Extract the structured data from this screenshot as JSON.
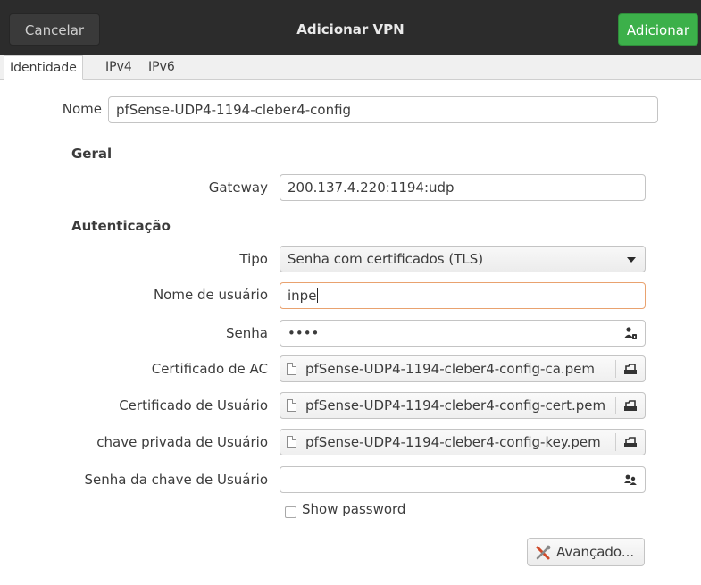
{
  "header": {
    "cancel_label": "Cancelar",
    "title": "Adicionar VPN",
    "add_label": "Adicionar"
  },
  "tabs": [
    {
      "label": "Identidade"
    },
    {
      "label": "IPv4"
    },
    {
      "label": "IPv6"
    }
  ],
  "form": {
    "name_label": "Nome",
    "name_value": "pfSense-UDP4-1194-cleber4-config",
    "general_heading": "Geral",
    "gateway_label": "Gateway",
    "gateway_value": "200.137.4.220:1194:udp",
    "auth_heading": "Autenticação",
    "type_label": "Tipo",
    "type_value": "Senha com certificados (TLS)",
    "username_label": "Nome de usuário",
    "username_value": "inpe",
    "password_label": "Senha",
    "password_value": "••••",
    "ca_cert_label": "Certificado de AC",
    "ca_cert_file": "pfSense-UDP4-1194-cleber4-config-ca.pem",
    "user_cert_label": "Certificado de Usuário",
    "user_cert_file": "pfSense-UDP4-1194-cleber4-config-cert.pem",
    "user_key_label": "chave privada de Usuário",
    "user_key_file": "pfSense-UDP4-1194-cleber4-config-key.pem",
    "key_password_label": "Senha da chave de Usuário",
    "key_password_value": "",
    "show_password_label": "Show password",
    "advanced_label": "Avançado..."
  },
  "colors": {
    "header_bg": "#2c2c2c",
    "add_button": "#3cb04a",
    "focus_border": "#e9a26f"
  },
  "icons": {
    "password_field": "user-password-icon",
    "file": "document-icon",
    "open_file": "folder-open-icon",
    "advanced": "tools-icon"
  }
}
